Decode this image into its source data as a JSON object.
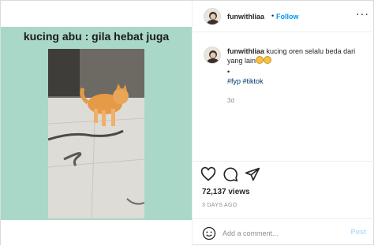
{
  "media": {
    "overlay_caption": "kucing abu : gila hebat juga"
  },
  "header": {
    "username": "funwithliaa",
    "separator": "•",
    "follow_label": "Follow",
    "more_label": "···"
  },
  "caption": {
    "username": "funwithliaa",
    "text": "kucing oren selalu beda dari yang lain",
    "bullet": "•",
    "hashtags": "#fyp #tiktok",
    "age": "3d"
  },
  "stats": {
    "views": "72,137 views",
    "time_ago": "3 DAYS AGO"
  },
  "comment_box": {
    "placeholder": "Add a comment...",
    "post_label": "Post"
  },
  "colors": {
    "accent": "#0095f6",
    "media_background": "#a9d7c8",
    "post_disabled": "#b2dffc"
  },
  "icons": [
    "heart-icon",
    "comment-icon",
    "share-icon",
    "emoji-icon",
    "more-icon"
  ]
}
